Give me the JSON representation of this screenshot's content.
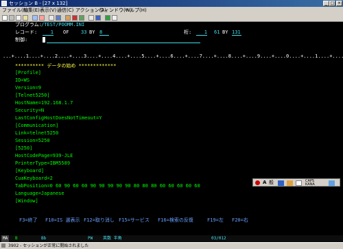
{
  "window": {
    "title": "セッション B - [27 x 132]"
  },
  "menu": [
    "ファイル(F)",
    "編集(E)",
    "表示(V)",
    "通信(C)",
    "アクション(A)",
    "ウィンドウ(W)",
    "ヘルプ(H)"
  ],
  "header": {
    "program_label": "プログラム:",
    "program_value": "/TEST/POOMM.INI",
    "record_label": "レコード:",
    "record_value": "1",
    "of_label": "OF",
    "record_total": "33",
    "by_label": "BY",
    "record_by": "8",
    "column_label": "桁:",
    "column_value": "1",
    "col_of": "61",
    "col_by": "131",
    "control_label": "制御:"
  },
  "ruler": "...+....1....+....2....+....3....+....4....+....5....+....6....+....7....+....8....+....9....+....0....+....1....+....2....+....3",
  "data_start": "********** データの始め *************",
  "lines": [
    "[Profile]",
    "ID=WS",
    "Version=9",
    "[Telnet5250]",
    "HostName=192.168.1.7",
    "Security=N",
    "LastConfigHostDoesNotTimeout=Y",
    "[Communication]",
    "Link=telnet5250",
    "Session=5250",
    "[5250]",
    "HostCodePage=939-JLE",
    "PrinterType=IBM5589",
    "[Keyboard]",
    "CuaKeyboard=2",
    "TabPosition=0 60 90 60 60 90 90 90 90 90 80 80 80 60 60 60 60 60",
    "Language=Japanese",
    "[Window]"
  ],
  "function_keys": [
    "F3=終了",
    "F10=IS 選表示",
    "F12=取り消し",
    "F15=サービス",
    "F16=検索の反復",
    "F19=左",
    "F20=右"
  ],
  "ime": {
    "mode": "A",
    "label": "般",
    "caps": "CAPS",
    "kana": "KANA"
  },
  "status_bar": {
    "indicator": "MA",
    "left_code": "B",
    "field1": "Bb",
    "field2": "PW",
    "ime_mode": "英数 半角",
    "cursor_pos": "03/012"
  },
  "message": "3902 - セッションが正常に開始されました",
  "colors": {
    "terminal_bg": "#000000",
    "text_green": "#00ff00",
    "text_cyan": "#40e0f0"
  }
}
